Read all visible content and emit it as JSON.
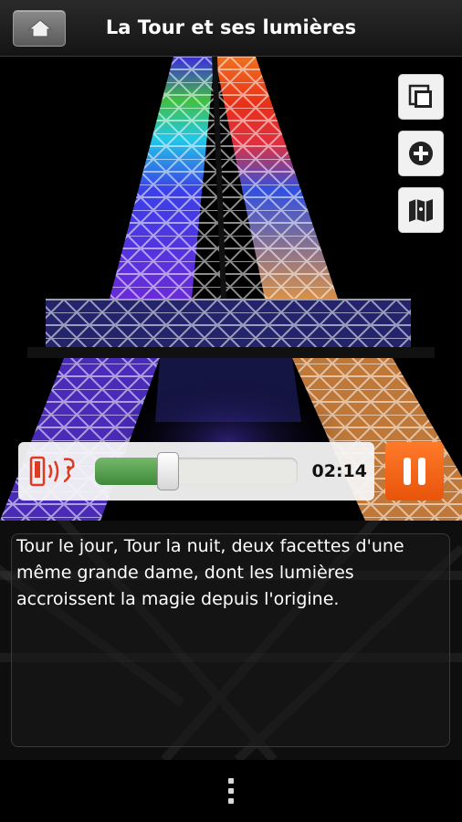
{
  "header": {
    "title": "La Tour et ses lumières",
    "home_icon": "home-icon"
  },
  "side_buttons": [
    {
      "icon": "gallery-icon"
    },
    {
      "icon": "zoom-in-icon"
    },
    {
      "icon": "map-icon"
    }
  ],
  "player": {
    "audio_icon": "phone-speaker-icon",
    "time": "02:14",
    "progress": 0.36,
    "state_icon": "pause-icon",
    "accent": "#e8540a"
  },
  "description": {
    "text": "Tour le jour, Tour la nuit, deux facettes d'une même grande dame, dont les lumières accroissent la magie depuis l'origine."
  },
  "navigation": {
    "menu_icon": "overflow-menu-icon"
  }
}
